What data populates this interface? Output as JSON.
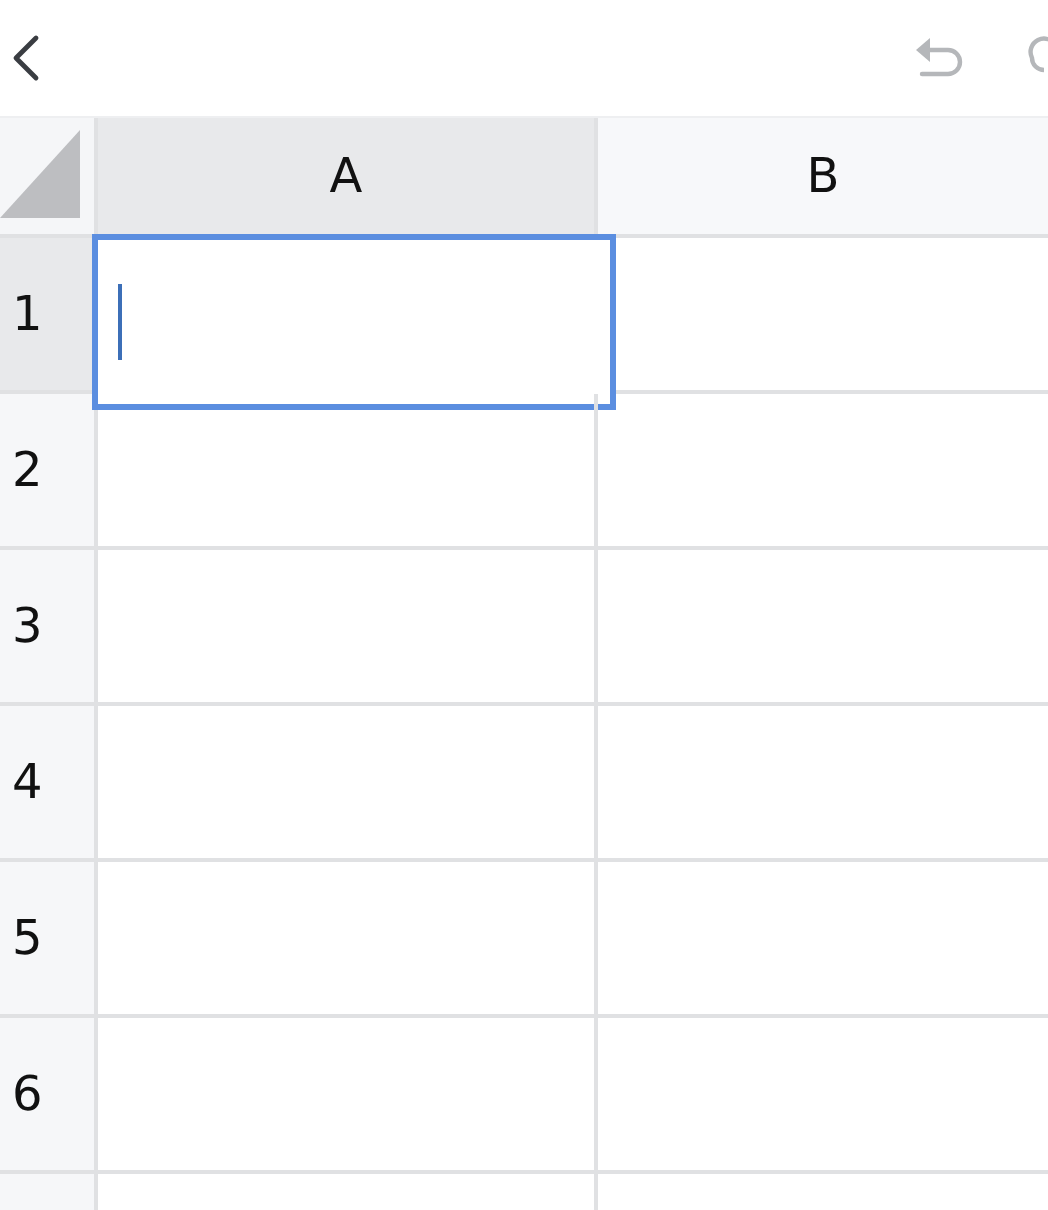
{
  "toolbar": {
    "undo_disabled": true
  },
  "columns": [
    {
      "label": "A",
      "selected": true
    },
    {
      "label": "B",
      "selected": false
    }
  ],
  "rows": [
    {
      "label": "1",
      "selected": true
    },
    {
      "label": "2",
      "selected": false
    },
    {
      "label": "3",
      "selected": false
    },
    {
      "label": "4",
      "selected": false
    },
    {
      "label": "5",
      "selected": false
    },
    {
      "label": "6",
      "selected": false
    }
  ],
  "active_cell": {
    "editing": true
  }
}
